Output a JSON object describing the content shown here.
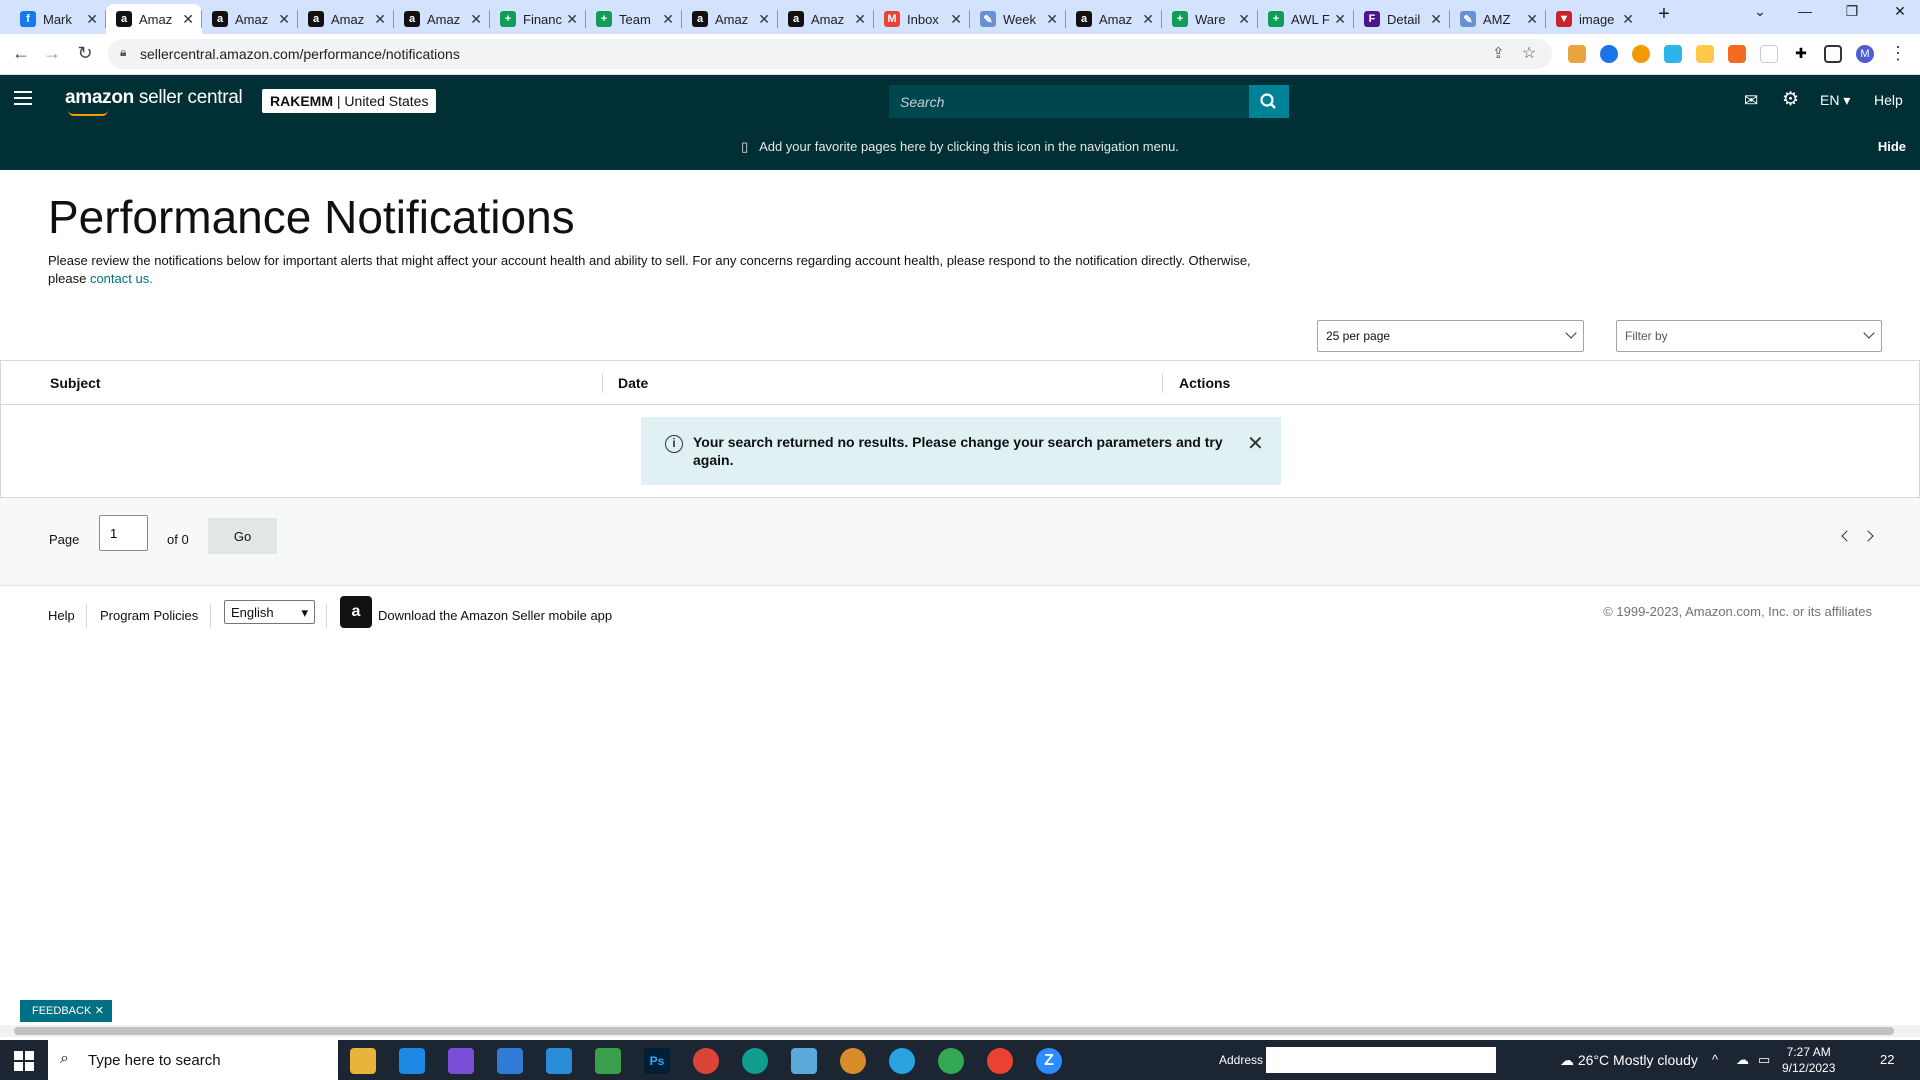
{
  "browser": {
    "tabs": [
      {
        "title": "Mark",
        "icon": "facebook-icon",
        "color": "#1877f2",
        "glyph": "f"
      },
      {
        "title": "Amaz",
        "icon": "amazon-icon",
        "color": "#111111",
        "glyph": "a",
        "active": true
      },
      {
        "title": "Amaz",
        "icon": "amazon-icon",
        "color": "#111111",
        "glyph": "a"
      },
      {
        "title": "Amaz",
        "icon": "amazon-icon",
        "color": "#111111",
        "glyph": "a"
      },
      {
        "title": "Amaz",
        "icon": "amazon-icon",
        "color": "#111111",
        "glyph": "a"
      },
      {
        "title": "Financ",
        "icon": "sheets-icon",
        "color": "#0f9d58",
        "glyph": "+"
      },
      {
        "title": "Team",
        "icon": "sheets-icon",
        "color": "#0f9d58",
        "glyph": "+"
      },
      {
        "title": "Amaz",
        "icon": "amazon-icon",
        "color": "#111111",
        "glyph": "a"
      },
      {
        "title": "Amaz",
        "icon": "amazon-icon",
        "color": "#111111",
        "glyph": "a"
      },
      {
        "title": "Inbox",
        "icon": "gmail-icon",
        "color": "#ea4335",
        "glyph": "M"
      },
      {
        "title": "Week",
        "icon": "wand-icon",
        "color": "#6b8fd6",
        "glyph": "✎"
      },
      {
        "title": "Amaz",
        "icon": "amazon-icon",
        "color": "#111111",
        "glyph": "a"
      },
      {
        "title": "Ware",
        "icon": "sheets-icon",
        "color": "#0f9d58",
        "glyph": "+"
      },
      {
        "title": "AWL F",
        "icon": "sheets-icon",
        "color": "#0f9d58",
        "glyph": "+"
      },
      {
        "title": "Detail",
        "icon": "fedex-icon",
        "color": "#4d148c",
        "glyph": "F"
      },
      {
        "title": "AMZ",
        "icon": "wand-icon",
        "color": "#6b8fd6",
        "glyph": "✎"
      },
      {
        "title": "image",
        "icon": "pinterest-icon",
        "color": "#c8232c",
        "glyph": "▼"
      }
    ],
    "url": "sellercentral.amazon.com/performance/notifications"
  },
  "header": {
    "logo_bold": "amazon",
    "logo_rest": " seller central",
    "account_name": "RAKEMM",
    "account_region": "| United States",
    "search_placeholder": "Search",
    "language": "EN",
    "help": "Help"
  },
  "favorites_bar": {
    "text": "Add your favorite pages here by clicking this icon in the navigation menu.",
    "hide": "Hide"
  },
  "page": {
    "title": "Performance Notifications",
    "description": "Please review the notifications below for important alerts that might affect your account health and ability to sell. For any concerns regarding account health, please respond to the notification directly. Otherwise, please",
    "contact_link": "contact us.",
    "per_page": "25 per page",
    "filter_placeholder": "Filter by"
  },
  "table": {
    "columns": [
      "Subject",
      "Date",
      "Actions"
    ],
    "empty_message": "Your search returned no results. Please change your search parameters and try again."
  },
  "pagination": {
    "page_label": "Page",
    "current_page": "1",
    "of_label": "of 0",
    "go_label": "Go"
  },
  "footer": {
    "help": "Help",
    "policies": "Program Policies",
    "language": "English",
    "app_text": "Download the Amazon Seller mobile app",
    "copyright": "© 1999-2023, Amazon.com, Inc. or its affiliates"
  },
  "feedback": "FEEDBACK",
  "taskbar": {
    "search_placeholder": "Type here to search",
    "address_label": "Address",
    "weather": "26°C  Mostly cloudy",
    "time": "7:27 AM",
    "date": "9/12/2023",
    "notifications": "22"
  },
  "colors": {
    "header_bg": "#002f36",
    "accent": "#008296",
    "link": "#007185",
    "alert_bg": "#e0f0f3"
  }
}
